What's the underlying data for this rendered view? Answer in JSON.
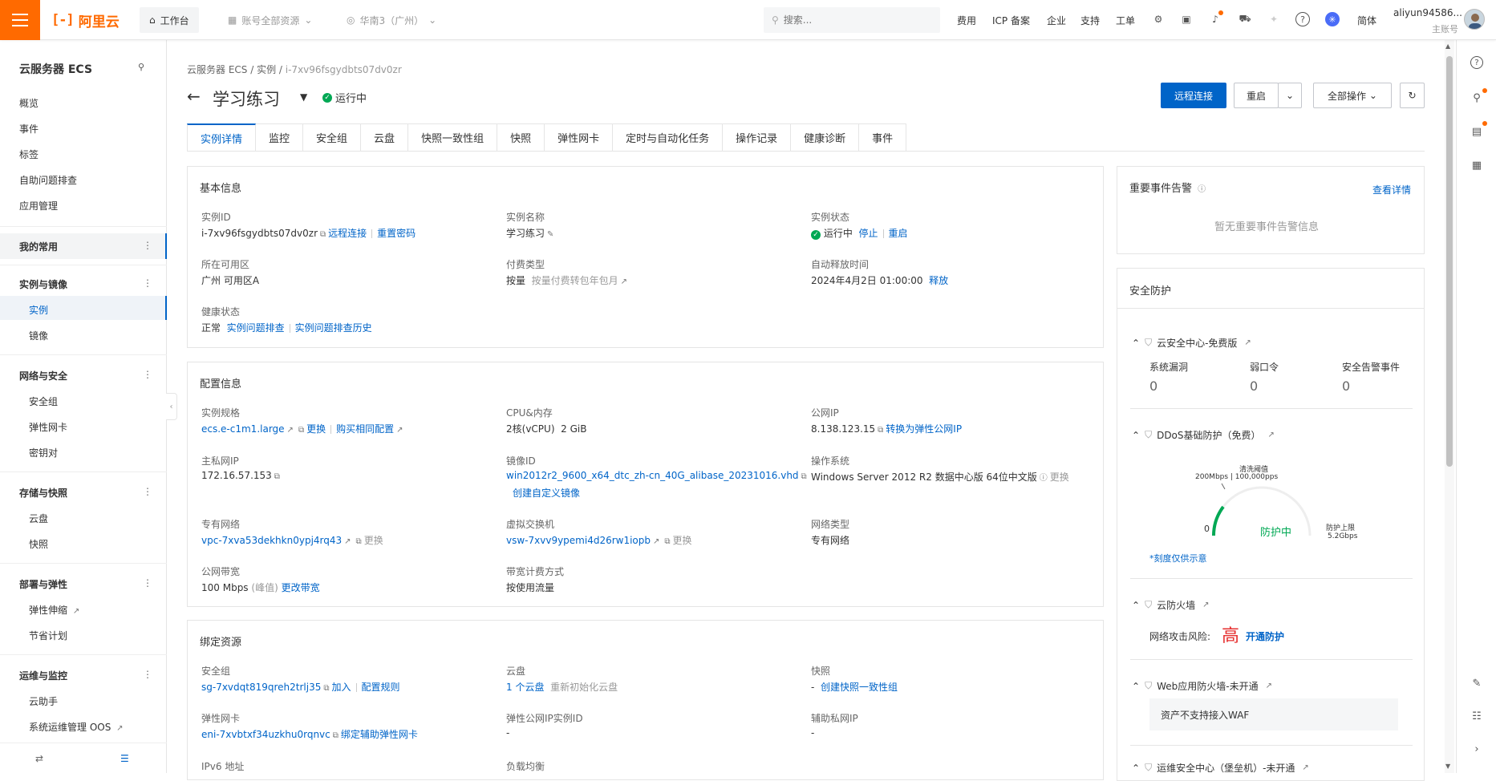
{
  "topbar": {
    "logo_text": "阿里云",
    "workbench": "工作台",
    "account_scope": "账号全部资源",
    "region": "华南3（广州）",
    "search_placeholder": "搜索...",
    "nav": [
      "费用",
      "ICP 备案",
      "企业",
      "支持",
      "工单"
    ],
    "lang": "简体",
    "user_name": "aliyun94586...",
    "user_role": "主账号"
  },
  "sidebar": {
    "title": "云服务器 ECS",
    "top_items": [
      "概览",
      "事件",
      "标签",
      "自助问题排查",
      "应用管理"
    ],
    "my_fav": "我的常用",
    "groups": [
      {
        "title": "实例与镜像",
        "items": [
          "实例",
          "镜像"
        ]
      },
      {
        "title": "网络与安全",
        "items": [
          "安全组",
          "弹性网卡",
          "密钥对"
        ]
      },
      {
        "title": "存储与快照",
        "items": [
          "云盘",
          "快照"
        ]
      },
      {
        "title": "部署与弹性",
        "items": [
          "弹性伸缩",
          "节省计划"
        ]
      },
      {
        "title": "运维与监控",
        "items": [
          "云助手",
          "系统运维管理 OOS"
        ]
      }
    ]
  },
  "breadcrumb": {
    "a": "云服务器 ECS",
    "b": "实例",
    "c": "i-7xv96fsgydbts07dv0zr"
  },
  "header": {
    "title": "学习练习",
    "status": "运行中",
    "btn_remote": "远程连接",
    "btn_restart": "重启",
    "btn_all_ops": "全部操作"
  },
  "tabs": [
    "实例详情",
    "监控",
    "安全组",
    "云盘",
    "快照一致性组",
    "快照",
    "弹性网卡",
    "定时与自动化任务",
    "操作记录",
    "健康诊断",
    "事件"
  ],
  "basic": {
    "title": "基本信息",
    "id_label": "实例ID",
    "id_value": "i-7xv96fsgydbts07dv0zr",
    "id_link1": "远程连接",
    "id_link2": "重置密码",
    "name_label": "实例名称",
    "name_value": "学习练习",
    "state_label": "实例状态",
    "state_value": "运行中",
    "state_link1": "停止",
    "state_link2": "重启",
    "zone_label": "所在可用区",
    "zone_value": "广州 可用区A",
    "pay_label": "付费类型",
    "pay_value": "按量",
    "pay_link": "按量付费转包年包月",
    "release_label": "自动释放时间",
    "release_value": "2024年4月2日 01:00:00",
    "release_link": "释放",
    "health_label": "健康状态",
    "health_value": "正常",
    "health_link1": "实例问题排查",
    "health_link2": "实例问题排查历史"
  },
  "config": {
    "title": "配置信息",
    "spec_label": "实例规格",
    "spec_value": "ecs.e-c1m1.large",
    "spec_link1": "更换",
    "spec_link2": "购买相同配置",
    "cpu_label": "CPU&内存",
    "cpu_value": "2核(vCPU)",
    "mem_value": "2 GiB",
    "pubip_label": "公网IP",
    "pubip_value": "8.138.123.15",
    "pubip_link": "转换为弹性公网IP",
    "privip_label": "主私网IP",
    "privip_value": "172.16.57.153",
    "image_label": "镜像ID",
    "image_value": "win2012r2_9600_x64_dtc_zh-cn_40G_alibase_20231016.vhd",
    "image_link": "创建自定义镜像",
    "os_label": "操作系统",
    "os_value": "Windows Server 2012 R2 数据中心版 64位中文版",
    "os_link": "更换",
    "vpc_label": "专有网络",
    "vpc_value": "vpc-7xva53dekhkn0ypj4rq43",
    "vpc_link": "更换",
    "vsw_label": "虚拟交换机",
    "vsw_value": "vsw-7xvv9ypemi4d26rw1iopb",
    "vsw_link": "更换",
    "nettype_label": "网络类型",
    "nettype_value": "专有网络",
    "bw_label": "公网带宽",
    "bw_value": "100 Mbps",
    "bw_peak": "(峰值)",
    "bw_link": "更改带宽",
    "billing_label": "带宽计费方式",
    "billing_value": "按使用流量"
  },
  "bound": {
    "title": "绑定资源",
    "sg_label": "安全组",
    "sg_value": "sg-7xvdqt819qreh2trlj35",
    "sg_link1": "加入",
    "sg_link2": "配置规则",
    "disk_label": "云盘",
    "disk_value": "1 个云盘",
    "disk_link": "重新初始化云盘",
    "snap_label": "快照",
    "snap_value": "-",
    "snap_link": "创建快照一致性组",
    "eni_label": "弹性网卡",
    "eni_value": "eni-7xvbtxf34uzkhu0rqnvc",
    "eni_link": "绑定辅助弹性网卡",
    "eip_label": "弹性公网IP实例ID",
    "eip_value": "-",
    "sec_ip_label": "辅助私网IP",
    "sec_ip_value": "-",
    "ipv6_label": "IPv6 地址",
    "lb_label": "负载均衡"
  },
  "events": {
    "title": "重要事件告警",
    "link": "查看详情",
    "empty": "暂无重要事件告警信息"
  },
  "security": {
    "title": "安全防护",
    "center": "云安全中心-免费版",
    "vuln_label": "系统漏洞",
    "vuln_value": "0",
    "weak_label": "弱口令",
    "weak_value": "0",
    "alert_label": "安全告警事件",
    "alert_value": "0",
    "ddos": "DDoS基础防护（免费）",
    "ddos_threshold_label": "清洗阈值",
    "ddos_threshold_value": "200Mbps | 100,000pps",
    "ddos_zero": "0",
    "ddos_state": "防护中",
    "ddos_upper_label": "防护上限",
    "ddos_upper_value": "5.2Gbps",
    "ddos_note": "*刻度仅供示意",
    "firewall": "云防火墙",
    "risk_label": "网络攻击风险:",
    "risk_value": "高",
    "risk_link": "开通防护",
    "waf": "Web应用防火墙-未开通",
    "waf_note": "资产不支持接入WAF",
    "bastion": "运维安全中心（堡垒机）-未开通"
  }
}
